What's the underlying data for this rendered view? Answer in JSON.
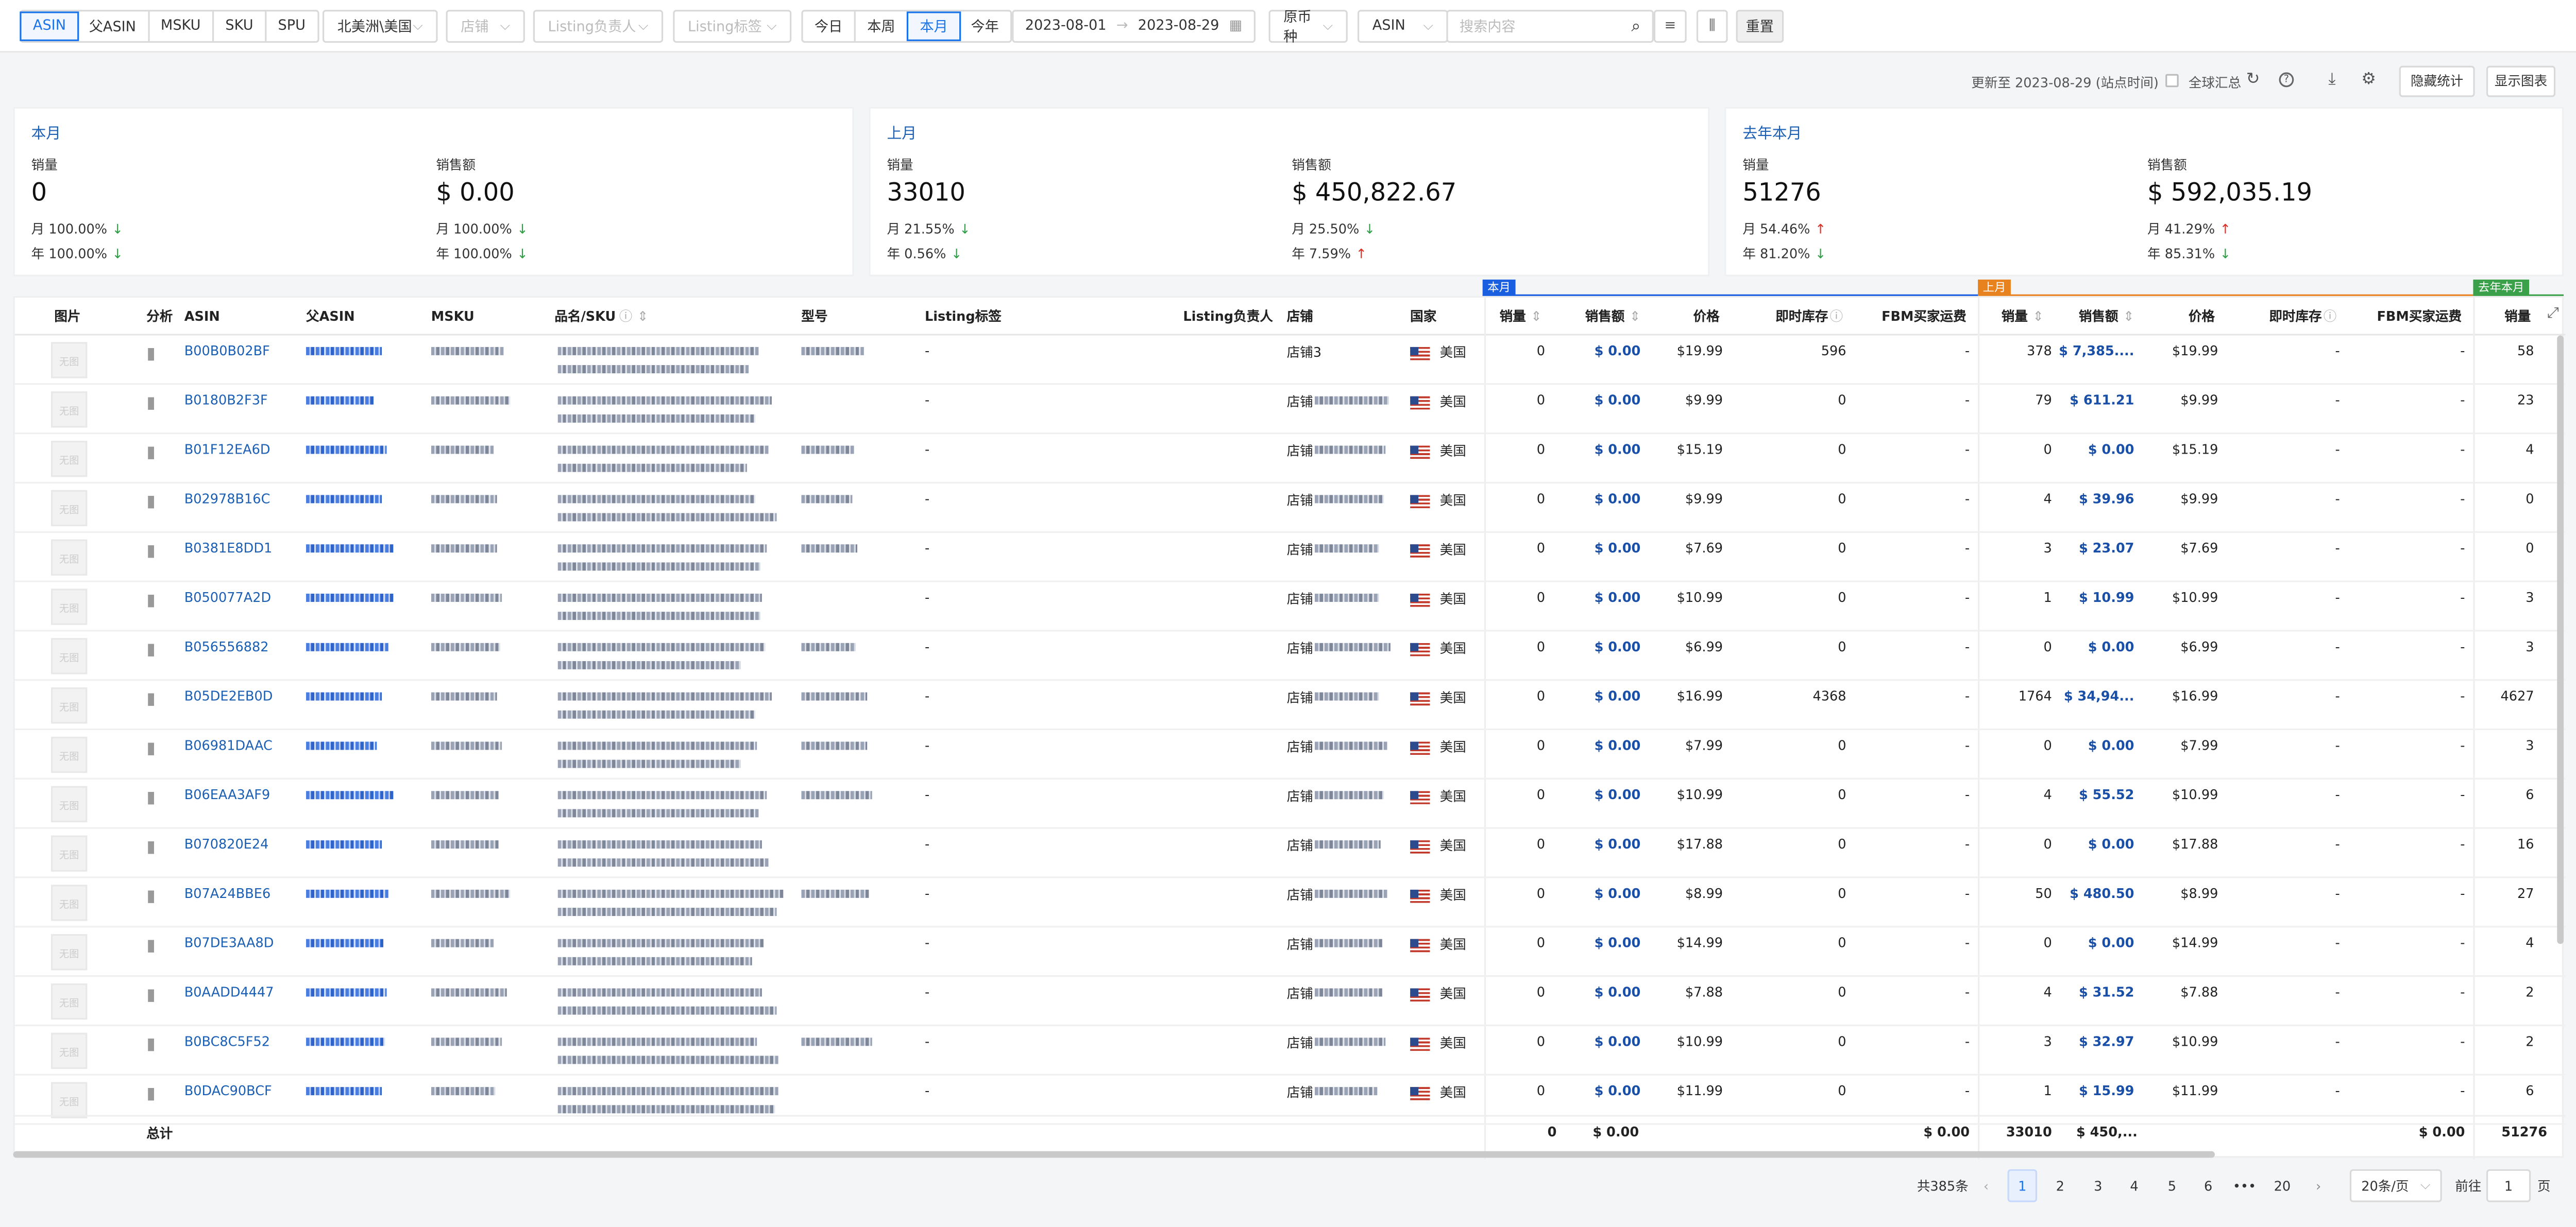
{
  "toolbar": {
    "dims": [
      "ASIN",
      "父ASIN",
      "MSKU",
      "SKU",
      "SPU"
    ],
    "region": "北美洲\\美国",
    "store_ph": "店铺",
    "owner_ph": "Listing负责人",
    "tag_ph": "Listing标签",
    "periods": [
      "今日",
      "本周",
      "本月",
      "今年"
    ],
    "date_start": "2023-08-01",
    "date_end": "2023-08-29",
    "currency": "原币种",
    "search_field": "ASIN",
    "search_ph": "搜索内容",
    "reset": "重置"
  },
  "subbar": {
    "updated": "更新至 2023-08-29 (站点时间)",
    "global_summary": "全球汇总",
    "hide_stats": "隐藏统计",
    "show_chart": "显示图表"
  },
  "cards": [
    {
      "title": "本月",
      "qty_label": "销量",
      "qty": "0",
      "amt_label": "销售额",
      "amt": "$ 0.00",
      "qm": "100.00%",
      "qy": "100.00%",
      "am": "100.00%",
      "ay": "100.00%",
      "qm_dir": "down",
      "qy_dir": "down",
      "am_dir": "down",
      "ay_dir": "down",
      "m": "月",
      "y": "年"
    },
    {
      "title": "上月",
      "qty_label": "销量",
      "qty": "33010",
      "amt_label": "销售额",
      "amt": "$ 450,822.67",
      "qm": "21.55%",
      "qy": "0.56%",
      "am": "25.50%",
      "ay": "7.59%",
      "qm_dir": "down",
      "qy_dir": "down",
      "am_dir": "down",
      "ay_dir": "up",
      "m": "月",
      "y": "年"
    },
    {
      "title": "去年本月",
      "qty_label": "销量",
      "qty": "51276",
      "amt_label": "销售额",
      "amt": "$ 592,035.19",
      "qm": "54.46%",
      "qy": "81.20%",
      "am": "41.29%",
      "ay": "85.31%",
      "qm_dir": "up",
      "qy_dir": "down",
      "am_dir": "up",
      "ay_dir": "down",
      "m": "月",
      "y": "年"
    }
  ],
  "group_tags": {
    "this_month": "本月",
    "last_month": "上月",
    "last_year": "去年本月"
  },
  "headers": {
    "img": "图片",
    "analysis": "分析",
    "asin": "ASIN",
    "parent": "父ASIN",
    "msku": "MSKU",
    "name": "品名/SKU",
    "model": "型号",
    "tag": "Listing标签",
    "owner": "Listing负责人",
    "store": "店铺",
    "country": "国家",
    "qty": "销量",
    "amt": "销售额",
    "price": "价格",
    "stock": "即时库存",
    "fbm": "FBM买家运费"
  },
  "rows": [
    {
      "asin": "B00B0B02BF",
      "store": "店铺3",
      "c": "美国",
      "tag": "-",
      "q1": "0",
      "a1": "$ 0.00",
      "p1": "$19.99",
      "s1": "596",
      "f1": "-",
      "q2": "378",
      "a2": "$ 7,385....",
      "p2": "$19.99",
      "s2": "-",
      "f2": "-",
      "q3": "58"
    },
    {
      "asin": "B0180B2F3F",
      "store": "店铺",
      "c": "美国",
      "tag": "-",
      "q1": "0",
      "a1": "$ 0.00",
      "p1": "$9.99",
      "s1": "0",
      "f1": "-",
      "q2": "79",
      "a2": "$ 611.21",
      "p2": "$9.99",
      "s2": "-",
      "f2": "-",
      "q3": "23"
    },
    {
      "asin": "B01F12EA6D",
      "store": "店铺",
      "c": "美国",
      "tag": "-",
      "q1": "0",
      "a1": "$ 0.00",
      "p1": "$15.19",
      "s1": "0",
      "f1": "-",
      "q2": "0",
      "a2": "$ 0.00",
      "p2": "$15.19",
      "s2": "-",
      "f2": "-",
      "q3": "4"
    },
    {
      "asin": "B02978B16C",
      "store": "店铺",
      "c": "美国",
      "tag": "-",
      "q1": "0",
      "a1": "$ 0.00",
      "p1": "$9.99",
      "s1": "0",
      "f1": "-",
      "q2": "4",
      "a2": "$ 39.96",
      "p2": "$9.99",
      "s2": "-",
      "f2": "-",
      "q3": "0"
    },
    {
      "asin": "B0381E8DD1",
      "store": "店铺",
      "c": "美国",
      "tag": "-",
      "q1": "0",
      "a1": "$ 0.00",
      "p1": "$7.69",
      "s1": "0",
      "f1": "-",
      "q2": "3",
      "a2": "$ 23.07",
      "p2": "$7.69",
      "s2": "-",
      "f2": "-",
      "q3": "0"
    },
    {
      "asin": "B050077A2D",
      "store": "店铺",
      "c": "美国",
      "tag": "-",
      "q1": "0",
      "a1": "$ 0.00",
      "p1": "$10.99",
      "s1": "0",
      "f1": "-",
      "q2": "1",
      "a2": "$ 10.99",
      "p2": "$10.99",
      "s2": "-",
      "f2": "-",
      "q3": "3"
    },
    {
      "asin": "B056556882",
      "store": "店铺",
      "c": "美国",
      "tag": "-",
      "q1": "0",
      "a1": "$ 0.00",
      "p1": "$6.99",
      "s1": "0",
      "f1": "-",
      "q2": "0",
      "a2": "$ 0.00",
      "p2": "$6.99",
      "s2": "-",
      "f2": "-",
      "q3": "3"
    },
    {
      "asin": "B05DE2EB0D",
      "store": "店铺",
      "c": "美国",
      "tag": "-",
      "q1": "0",
      "a1": "$ 0.00",
      "p1": "$16.99",
      "s1": "4368",
      "f1": "-",
      "q2": "1764",
      "a2": "$ 34,94...",
      "p2": "$16.99",
      "s2": "-",
      "f2": "-",
      "q3": "4627"
    },
    {
      "asin": "B06981DAAC",
      "store": "店铺",
      "c": "美国",
      "tag": "-",
      "q1": "0",
      "a1": "$ 0.00",
      "p1": "$7.99",
      "s1": "0",
      "f1": "-",
      "q2": "0",
      "a2": "$ 0.00",
      "p2": "$7.99",
      "s2": "-",
      "f2": "-",
      "q3": "3"
    },
    {
      "asin": "B06EAA3AF9",
      "store": "店铺",
      "c": "美国",
      "tag": "-",
      "q1": "0",
      "a1": "$ 0.00",
      "p1": "$10.99",
      "s1": "0",
      "f1": "-",
      "q2": "4",
      "a2": "$ 55.52",
      "p2": "$10.99",
      "s2": "-",
      "f2": "-",
      "q3": "6"
    },
    {
      "asin": "B070820E24",
      "store": "店铺",
      "c": "美国",
      "tag": "-",
      "q1": "0",
      "a1": "$ 0.00",
      "p1": "$17.88",
      "s1": "0",
      "f1": "-",
      "q2": "0",
      "a2": "$ 0.00",
      "p2": "$17.88",
      "s2": "-",
      "f2": "-",
      "q3": "16"
    },
    {
      "asin": "B07A24BBE6",
      "store": "店铺",
      "c": "美国",
      "tag": "-",
      "q1": "0",
      "a1": "$ 0.00",
      "p1": "$8.99",
      "s1": "0",
      "f1": "-",
      "q2": "50",
      "a2": "$ 480.50",
      "p2": "$8.99",
      "s2": "-",
      "f2": "-",
      "q3": "27"
    },
    {
      "asin": "B07DE3AA8D",
      "store": "店铺",
      "c": "美国",
      "tag": "-",
      "q1": "0",
      "a1": "$ 0.00",
      "p1": "$14.99",
      "s1": "0",
      "f1": "-",
      "q2": "0",
      "a2": "$ 0.00",
      "p2": "$14.99",
      "s2": "-",
      "f2": "-",
      "q3": "4"
    },
    {
      "asin": "B0AADD4447",
      "store": "店铺",
      "c": "美国",
      "tag": "-",
      "q1": "0",
      "a1": "$ 0.00",
      "p1": "$7.88",
      "s1": "0",
      "f1": "-",
      "q2": "4",
      "a2": "$ 31.52",
      "p2": "$7.88",
      "s2": "-",
      "f2": "-",
      "q3": "2"
    },
    {
      "asin": "B0BC8C5F52",
      "store": "店铺",
      "c": "美国",
      "tag": "-",
      "q1": "0",
      "a1": "$ 0.00",
      "p1": "$10.99",
      "s1": "0",
      "f1": "-",
      "q2": "3",
      "a2": "$ 32.97",
      "p2": "$10.99",
      "s2": "-",
      "f2": "-",
      "q3": "2"
    },
    {
      "asin": "B0DAC90BCF",
      "store": "店铺",
      "c": "美国",
      "tag": "-",
      "q1": "0",
      "a1": "$ 0.00",
      "p1": "$11.99",
      "s1": "0",
      "f1": "-",
      "q2": "1",
      "a2": "$ 15.99",
      "p2": "$11.99",
      "s2": "-",
      "f2": "-",
      "q3": "6"
    }
  ],
  "thumb_text": "无图",
  "total": {
    "label": "总计",
    "q1": "0",
    "a1": "$ 0.00",
    "f1": "$ 0.00",
    "q2": "33010",
    "a2": "$ 450,...",
    "f2": "$ 0.00",
    "q3": "51276"
  },
  "pager": {
    "total": "共385条",
    "pages": [
      "1",
      "2",
      "3",
      "4",
      "5",
      "6",
      "•••",
      "20"
    ],
    "page_size": "20条/页",
    "goto": "前往",
    "goto_val": "1",
    "page_unit": "页"
  },
  "colors": {
    "accent": "#1a73e8",
    "this_month": "#1a5fe0",
    "last_month": "#e8821e",
    "last_year": "#3aa14a",
    "down": "#2e9e44",
    "up": "#d93025"
  }
}
